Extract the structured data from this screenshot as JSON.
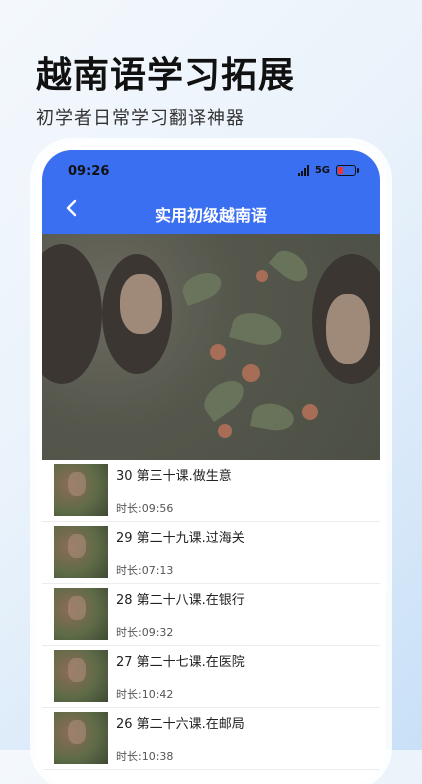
{
  "header": {
    "headline": "越南语学习拓展",
    "subline": "初学者日常学习翻译神器"
  },
  "status_bar": {
    "time": "09:26",
    "network": "5G"
  },
  "app_bar": {
    "title": "实用初级越南语",
    "back_icon": "chevron-left-icon"
  },
  "lessons": [
    {
      "title": "30 第三十课.做生意",
      "duration": "时长:09:56"
    },
    {
      "title": "29 第二十九课.过海关",
      "duration": "时长:07:13"
    },
    {
      "title": "28 第二十八课.在银行",
      "duration": "时长:09:32"
    },
    {
      "title": "27 第二十七课.在医院",
      "duration": "时长:10:42"
    },
    {
      "title": "26 第二十六课.在邮局",
      "duration": "时长:10:38"
    }
  ],
  "colors": {
    "accent": "#3b6ff2"
  }
}
